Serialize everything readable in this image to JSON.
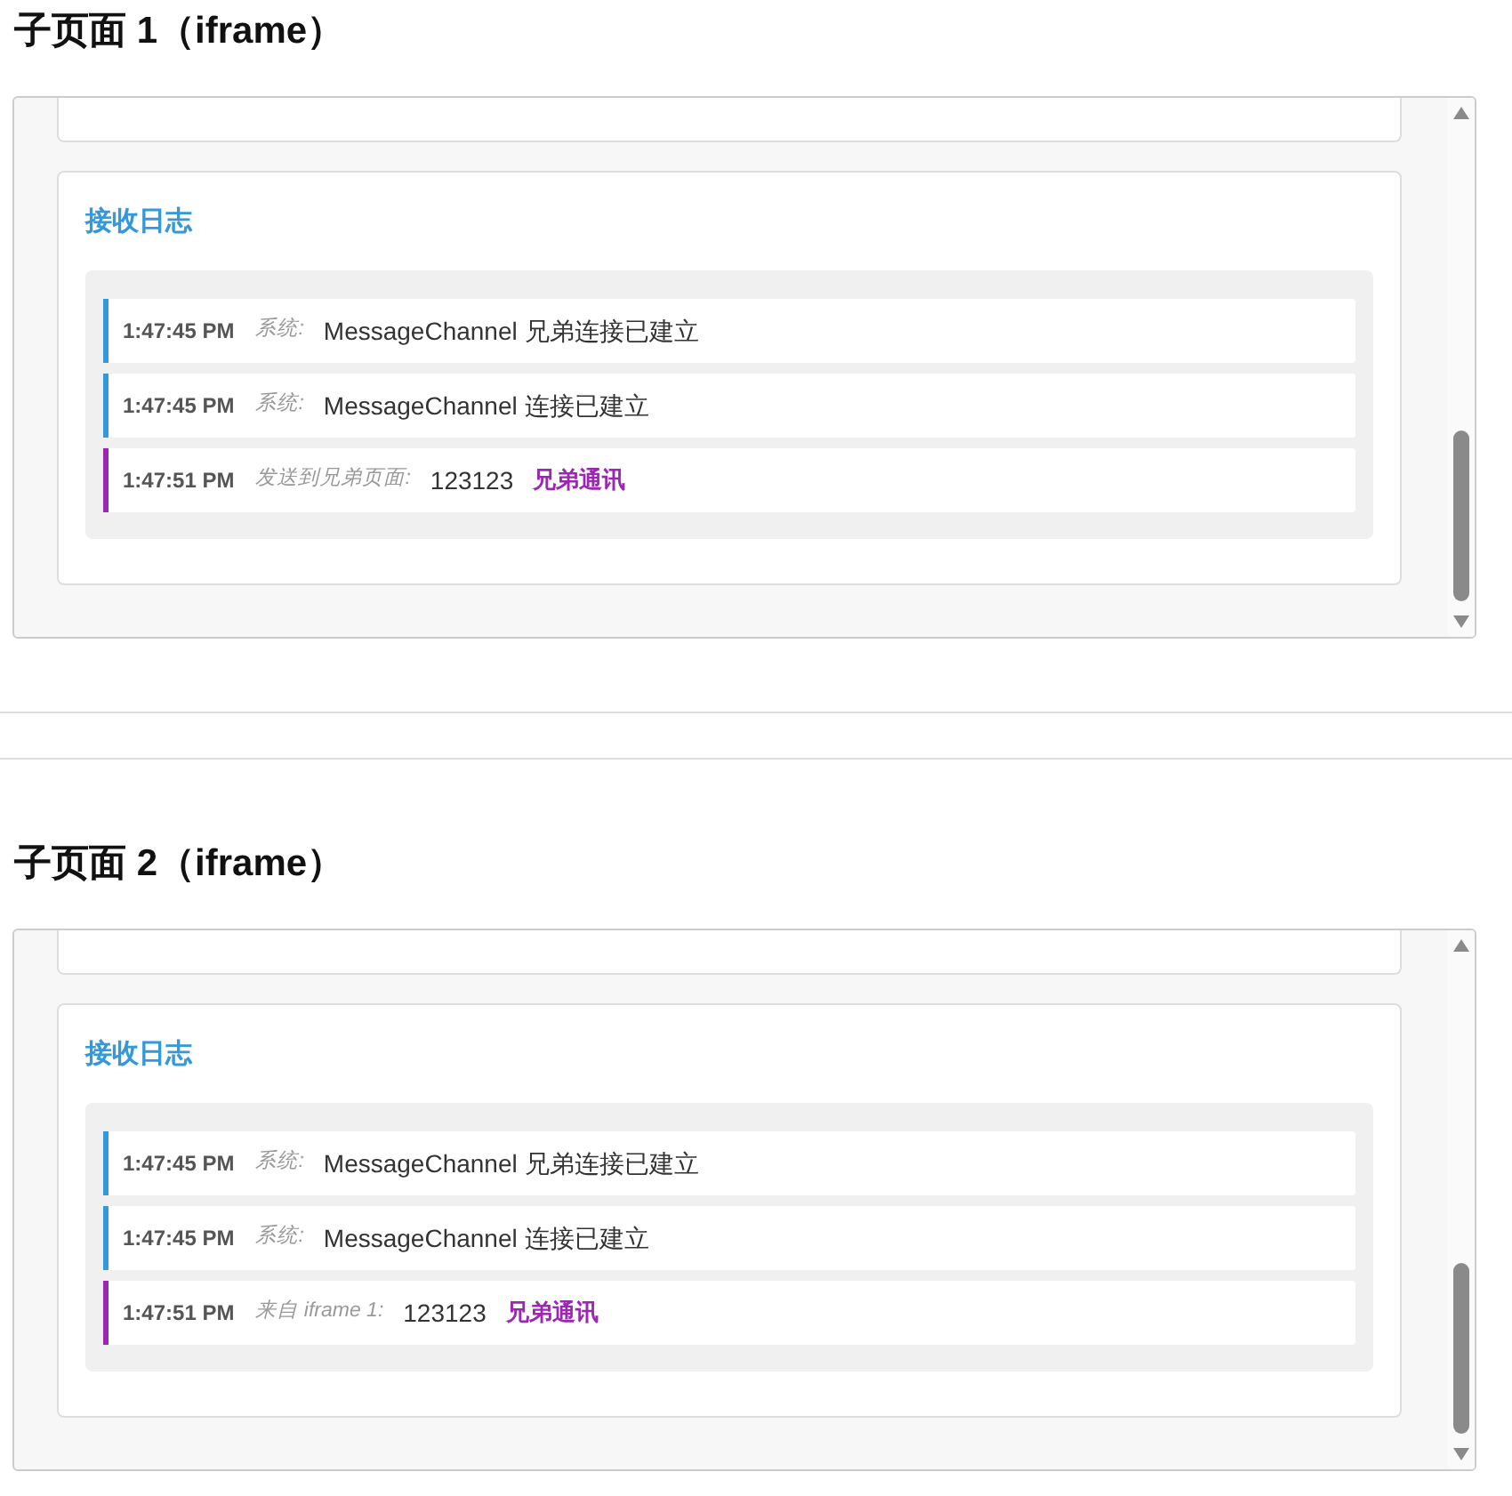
{
  "sections": [
    {
      "heading": "子页面 1（iframe）",
      "log_card": {
        "title": "接收日志",
        "entries": [
          {
            "kind": "system",
            "time": "1:47:45 PM",
            "source": "系统:",
            "message": "MessageChannel 兄弟连接已建立"
          },
          {
            "kind": "system",
            "time": "1:47:45 PM",
            "source": "系统:",
            "message": "MessageChannel 连接已建立"
          },
          {
            "kind": "sibling",
            "time": "1:47:51 PM",
            "source": "发送到兄弟页面:",
            "message": "123123",
            "tag": "兄弟通讯"
          }
        ]
      }
    },
    {
      "heading": "子页面 2（iframe）",
      "log_card": {
        "title": "接收日志",
        "entries": [
          {
            "kind": "system",
            "time": "1:47:45 PM",
            "source": "系统:",
            "message": "MessageChannel 兄弟连接已建立"
          },
          {
            "kind": "system",
            "time": "1:47:45 PM",
            "source": "系统:",
            "message": "MessageChannel 连接已建立"
          },
          {
            "kind": "sibling",
            "time": "1:47:51 PM",
            "source": "来自 iframe 1:",
            "message": "123123",
            "tag": "兄弟通讯"
          }
        ]
      }
    }
  ]
}
